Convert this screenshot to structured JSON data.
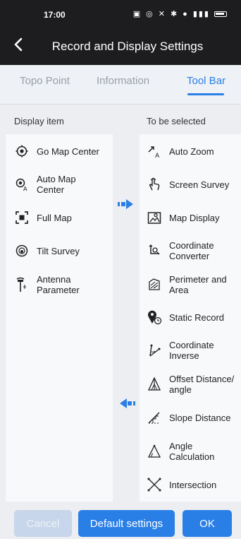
{
  "status": {
    "time": "17:00"
  },
  "appbar": {
    "title": "Record and Display Settings"
  },
  "tabs": [
    {
      "label": "Topo Point"
    },
    {
      "label": "Information"
    },
    {
      "label": "Tool Bar"
    }
  ],
  "columns": {
    "left": "Display item",
    "right": "To be selected"
  },
  "display_items": [
    {
      "label": "Go Map Center",
      "icon": "crosshair-icon"
    },
    {
      "label": "Auto Map Center",
      "icon": "auto-center-icon"
    },
    {
      "label": "Full Map",
      "icon": "full-map-icon"
    },
    {
      "label": "Tilt Survey",
      "icon": "tilt-icon"
    },
    {
      "label": "Antenna Parameter",
      "icon": "antenna-icon"
    }
  ],
  "selectable_items": [
    {
      "label": "Auto Zoom",
      "icon": "auto-zoom-icon"
    },
    {
      "label": "Screen Survey",
      "icon": "hand-icon"
    },
    {
      "label": "Map Display",
      "icon": "map-display-icon"
    },
    {
      "label": "Coordinate Converter",
      "icon": "converter-icon"
    },
    {
      "label": "Perimeter and Area",
      "icon": "area-icon"
    },
    {
      "label": "Static Record",
      "icon": "pin-clock-icon"
    },
    {
      "label": "Coordinate Inverse",
      "icon": "inverse-icon"
    },
    {
      "label": "Offset Distance/ angle",
      "icon": "offset-icon"
    },
    {
      "label": "Slope Distance",
      "icon": "slope-icon"
    },
    {
      "label": "Angle Calculation",
      "icon": "angle-icon"
    },
    {
      "label": "Intersection",
      "icon": "intersection-icon"
    }
  ],
  "footer": {
    "cancel": "Cancel",
    "default": "Default settings",
    "ok": "OK"
  },
  "colors": {
    "accent": "#2a7fe6",
    "dark": "#1d1d1f"
  }
}
